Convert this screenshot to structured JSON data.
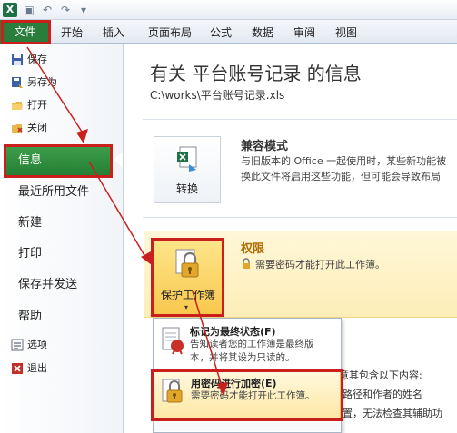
{
  "colors": {
    "accent_green": "#2a7d3b",
    "highlight_red": "#c9201d",
    "permission_yellow": "#fde68a"
  },
  "titlebar": {
    "app_icon": "excel-icon",
    "app_icon_glyph": "X",
    "save_glyph": "▣",
    "undo_glyph": "↶",
    "redo_glyph": "↷",
    "customize_glyph": "▾"
  },
  "ribbon": {
    "file_tab": "文件",
    "tabs": [
      "开始",
      "插入",
      "页面布局",
      "公式",
      "数据",
      "审阅",
      "视图"
    ]
  },
  "nav": {
    "small_items": [
      {
        "label": "保存",
        "icon": "save-icon"
      },
      {
        "label": "另存为",
        "icon": "save-as-icon"
      },
      {
        "label": "打开",
        "icon": "open-folder-icon"
      },
      {
        "label": "关闭",
        "icon": "close-file-icon"
      }
    ],
    "active_item": "信息",
    "items": [
      "最近所用文件",
      "新建",
      "打印",
      "保存并发送",
      "帮助"
    ],
    "bottom_items": [
      {
        "label": "选项",
        "icon": "options-icon"
      },
      {
        "label": "退出",
        "icon": "exit-icon"
      }
    ]
  },
  "info": {
    "title": "有关 平台账号记录 的信息",
    "path": "C:\\works\\平台账号记录.xls"
  },
  "compat": {
    "button_label": "转换",
    "title": "兼容模式",
    "desc_line1": "与旧版本的 Office 一起使用时，某些新功能被",
    "desc_line2": "换此文件将启用这些功能，但可能会导致布局"
  },
  "permissions": {
    "button_label": "保护工作簿",
    "caret": "▾",
    "title": "权限",
    "desc": "需要密码才能打开此工作簿。"
  },
  "background_text": {
    "line1": "意其包含以下内容:",
    "line2": "路径和作者的姓名",
    "line3": "置，无法检查其辅助功"
  },
  "protect_menu": {
    "items": [
      {
        "title": "标记为最终状态(F)",
        "desc_line1": "告知读者您的工作簿是最终版",
        "desc_line2": "本，并将其设为只读的。",
        "icon": "mark-final-icon"
      },
      {
        "title": "用密码进行加密(E)",
        "desc_line1": "需要密码才能打开此工作簿。",
        "desc_line2": "",
        "icon": "lock-key-icon"
      }
    ]
  }
}
